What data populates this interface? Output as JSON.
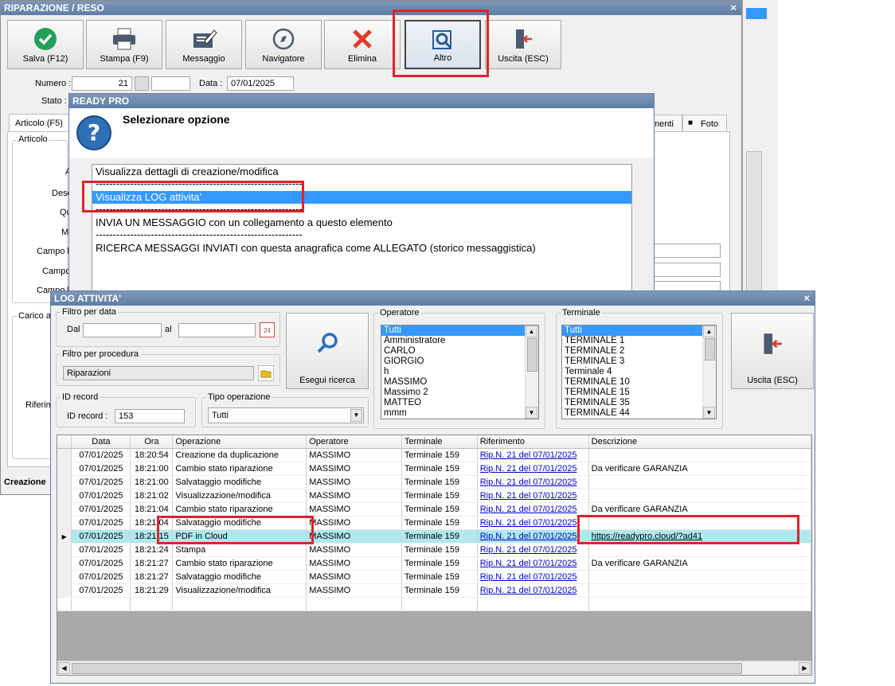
{
  "main_window": {
    "title": "RIPARAZIONE / RESO",
    "close_glyph": "×",
    "toolbar": [
      {
        "label": "Salva (F12)",
        "icon": "check-icon"
      },
      {
        "label": "Stampa (F9)",
        "icon": "printer-icon"
      },
      {
        "label": "Messaggio",
        "icon": "message-icon"
      },
      {
        "label": "Navigatore",
        "icon": "compass-icon"
      },
      {
        "label": "Elimina",
        "icon": "delete-x-icon"
      },
      {
        "label": "Altro",
        "icon": "magnifier-doc-icon"
      },
      {
        "label": "Uscita (ESC)",
        "icon": "exit-door-icon"
      }
    ],
    "numero_label": "Numero :",
    "numero_value": "21",
    "data_label": "Data :",
    "data_value": "07/01/2025",
    "stato_label": "Stato :",
    "tab_articolo": "Articolo (F5)",
    "tab_menti": "menti",
    "tab_foto": "Foto",
    "articolo_group": "Articolo",
    "side_labels": [
      "A",
      "Desc",
      "Qu",
      "M",
      "Campo li",
      "Campo li",
      "Campo li"
    ],
    "carico_label": "Carico a",
    "riferim_label": "Riferim",
    "creazione_label": "Creazione"
  },
  "ready_dialog": {
    "title": "READY PRO",
    "heading": "Selezionare opzione",
    "options": [
      "Visualizza dettagli di creazione/modifica",
      "------------------------------------------------------------",
      "Visualizza LOG attivita'",
      "------------------------------------------------------------",
      "INVIA UN MESSAGGIO con un collegamento a questo elemento",
      "------------------------------------------------------------",
      "RICERCA MESSAGGI INVIATI con questa anagrafica come ALLEGATO (storico messaggistica)"
    ]
  },
  "log_window": {
    "title": "LOG ATTIVITA'",
    "close_glyph": "×",
    "filtro_data": {
      "title": "Filtro per data",
      "dal_label": "Dal",
      "al_label": "al",
      "dal_value": "",
      "al_value": "",
      "calendar_day": "24"
    },
    "filtro_procedura": {
      "title": "Filtro per procedura",
      "value": "Riparazioni"
    },
    "id_record": {
      "title": "ID record",
      "label": "ID record :",
      "value": "153"
    },
    "tipo_operazione": {
      "title": "Tipo operazione",
      "value": "Tutti"
    },
    "search_button": "Esegui ricerca",
    "exit_button": "Uscita (ESC)",
    "operatore": {
      "title": "Operatore",
      "items": [
        "Tutti",
        "Amministratore",
        "CARLO",
        "GIORGIO",
        "h",
        "MASSIMO",
        "Massimo 2",
        "MATTEO",
        "mmm"
      ]
    },
    "terminale": {
      "title": "Terminale",
      "items": [
        "Tutti",
        "TERMINALE 1",
        "TERMINALE 2",
        "TERMINALE 3",
        "Terminale 4",
        "TERMINALE 10",
        "TERMINALE 15",
        "TERMINALE 35",
        "TERMINALE 44"
      ]
    },
    "columns": [
      "Data",
      "Ora",
      "Operazione",
      "Operatore",
      "Terminale",
      "Riferimento",
      "Descrizione"
    ],
    "rows": [
      [
        "07/01/2025",
        "18:20:54",
        "Creazione da duplicazione",
        "MASSIMO",
        "Terminale 159",
        "Rip.N. 21 del 07/01/2025",
        ""
      ],
      [
        "07/01/2025",
        "18:21:00",
        "Cambio stato riparazione",
        "MASSIMO",
        "Terminale 159",
        "Rip.N. 21 del 07/01/2025",
        "Da verificare GARANZIA"
      ],
      [
        "07/01/2025",
        "18:21:00",
        "Salvataggio modifiche",
        "MASSIMO",
        "Terminale 159",
        "Rip.N. 21 del 07/01/2025",
        ""
      ],
      [
        "07/01/2025",
        "18:21:02",
        "Visualizzazione/modifica",
        "MASSIMO",
        "Terminale 159",
        "Rip.N. 21 del 07/01/2025",
        ""
      ],
      [
        "07/01/2025",
        "18:21:04",
        "Cambio stato riparazione",
        "MASSIMO",
        "Terminale 159",
        "Rip.N. 21 del 07/01/2025",
        "Da verificare GARANZIA"
      ],
      [
        "07/01/2025",
        "18:21:04",
        "Salvataggio modifiche",
        "MASSIMO",
        "Terminale 159",
        "Rip.N. 21 del 07/01/2025",
        ""
      ],
      [
        "07/01/2025",
        "18:21:15",
        "PDF in Cloud",
        "MASSIMO",
        "Terminale 159",
        "Rip.N. 21 del 07/01/2025",
        "https://readypro.cloud/?ad41"
      ],
      [
        "07/01/2025",
        "18:21:24",
        "Stampa",
        "MASSIMO",
        "Terminale 159",
        "Rip.N. 21 del 07/01/2025",
        ""
      ],
      [
        "07/01/2025",
        "18:21:27",
        "Cambio stato riparazione",
        "MASSIMO",
        "Terminale 159",
        "Rip.N. 21 del 07/01/2025",
        "Da verificare GARANZIA"
      ],
      [
        "07/01/2025",
        "18:21:27",
        "Salvataggio modifiche",
        "MASSIMO",
        "Terminale 159",
        "Rip.N. 21 del 07/01/2025",
        ""
      ],
      [
        "07/01/2025",
        "18:21:29",
        "Visualizzazione/modifica",
        "MASSIMO",
        "Terminale 159",
        "Rip.N. 21 del 07/01/2025",
        ""
      ]
    ],
    "selected_row": 6,
    "row_pointer_glyph": "▶"
  },
  "colors": {
    "accent_red": "#e0222a",
    "selection_blue": "#3399ff",
    "highlight_row": "#b0e8ee",
    "link": "#0000cc"
  }
}
